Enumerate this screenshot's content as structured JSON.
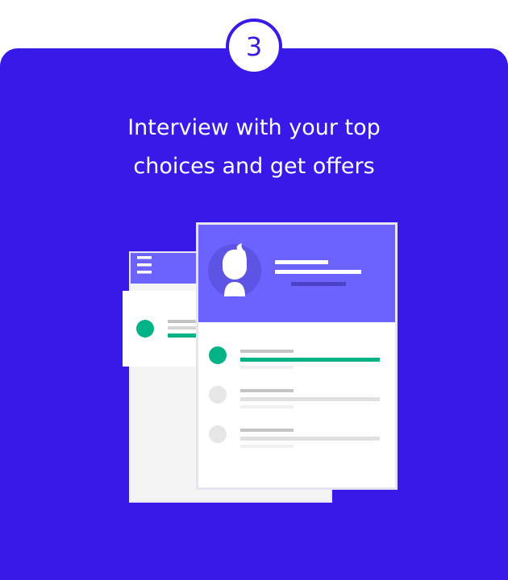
{
  "step": {
    "number": "3"
  },
  "headline": {
    "line1": "Interview with your top",
    "line2": "choices and get offers"
  },
  "colors": {
    "background": "#3719e8",
    "accent_header": "#6c63ff",
    "success": "#00b386",
    "inactive": "#e6e6e6"
  },
  "illustration": {
    "icons": [
      "menu-icon",
      "user-avatar-icon"
    ],
    "list_items": [
      {
        "status": "active"
      },
      {
        "status": "inactive"
      },
      {
        "status": "inactive"
      }
    ]
  }
}
